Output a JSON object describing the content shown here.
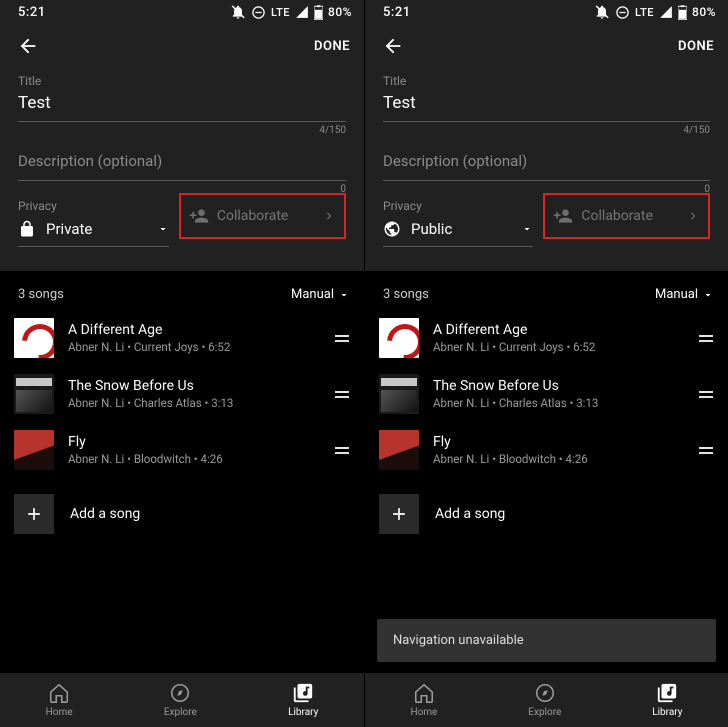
{
  "status": {
    "time": "5:21",
    "network": "LTE",
    "battery": "80%"
  },
  "header": {
    "done": "DONE"
  },
  "form": {
    "title_label": "Title",
    "title_value": "Test",
    "title_counter": "4/150",
    "desc_placeholder": "Description (optional)",
    "desc_counter": "0",
    "privacy_label": "Privacy",
    "collab_label": "Collaborate"
  },
  "left": {
    "privacy_value": "Private"
  },
  "right": {
    "privacy_value": "Public",
    "toast": "Navigation unavailable"
  },
  "songs": {
    "count_label": "3 songs",
    "sort_label": "Manual",
    "add_label": "Add a song",
    "items": [
      {
        "title": "A Different Age",
        "sub": "Abner N. Li • Current Joys • 6:52"
      },
      {
        "title": "The Snow Before Us",
        "sub": "Abner N. Li • Charles Atlas • 3:13"
      },
      {
        "title": "Fly",
        "sub": "Abner N. Li • Bloodwitch • 4:26"
      }
    ]
  },
  "nav": {
    "home": "Home",
    "explore": "Explore",
    "library": "Library"
  }
}
